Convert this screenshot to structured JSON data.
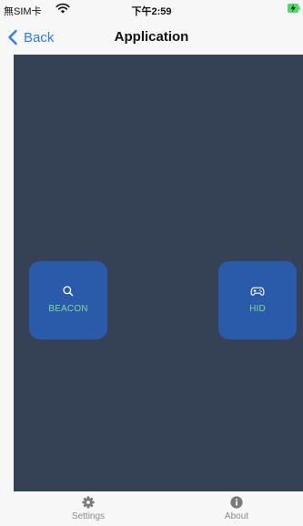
{
  "status_bar": {
    "carrier": "無SIM卡",
    "time": "下午2:59"
  },
  "nav": {
    "back_label": "Back",
    "title": "Application"
  },
  "tiles": [
    {
      "label": "BEACON",
      "icon": "search-icon"
    },
    {
      "label": "HID",
      "icon": "gamepad-icon"
    }
  ],
  "tabs": [
    {
      "label": "Settings",
      "icon": "gear-icon"
    },
    {
      "label": "About",
      "icon": "info-icon"
    }
  ],
  "colors": {
    "content_background": "#354154",
    "tile_background": "#2a5bab",
    "tile_label": "#7fd49a",
    "accent": "#2f7cf6",
    "battery": "#4cd964"
  }
}
